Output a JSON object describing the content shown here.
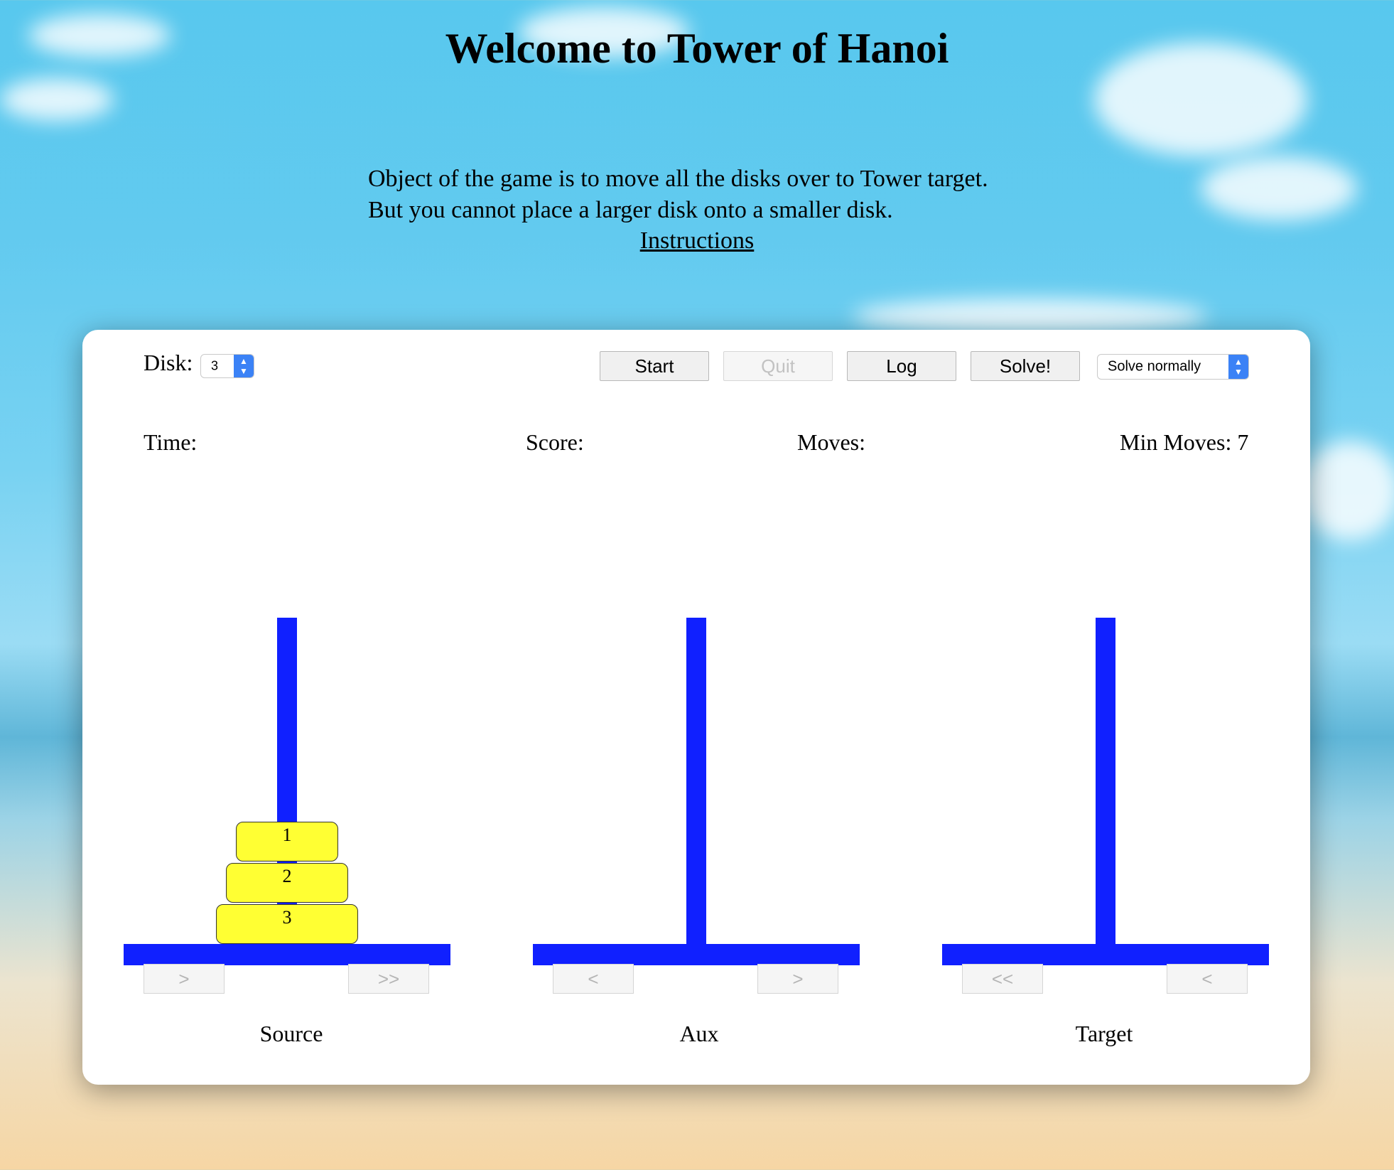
{
  "header": {
    "title": "Welcome to Tower of Hanoi",
    "line1": "Object of the game is to move all the disks over to Tower target.",
    "line2": "But you cannot place a larger disk onto a smaller disk.",
    "instructions_link": "Instructions"
  },
  "controls": {
    "disk_label": "Disk:",
    "disk_value": "3",
    "start_label": "Start",
    "quit_label": "Quit",
    "log_label": "Log",
    "solve_label": "Solve!",
    "mode_value": "Solve normally"
  },
  "stats": {
    "time_label": "Time:",
    "score_label": "Score:",
    "moves_label": "Moves:",
    "min_moves_label": "Min Moves: 7"
  },
  "towers": [
    {
      "name": "Source",
      "nav_left": ">",
      "nav_right": ">>"
    },
    {
      "name": "Aux",
      "nav_left": "<",
      "nav_right": ">"
    },
    {
      "name": "Target",
      "nav_left": "<<",
      "nav_right": "<"
    }
  ],
  "disks": [
    "1",
    "2",
    "3"
  ],
  "colors": {
    "pole": "#1020ff",
    "disk": "#ffff33"
  }
}
